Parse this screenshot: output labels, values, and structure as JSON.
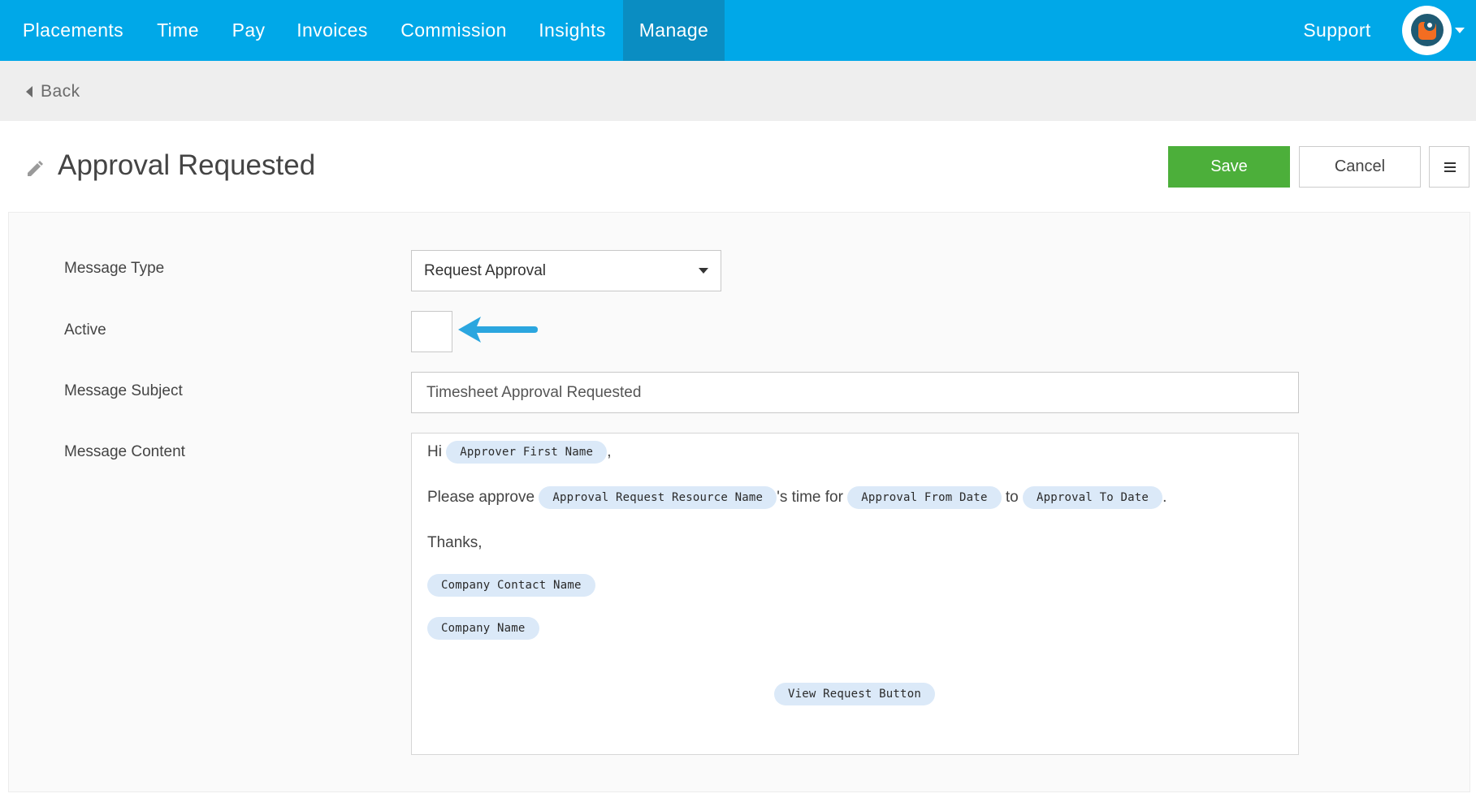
{
  "nav": {
    "items": [
      {
        "label": "Placements",
        "active": false
      },
      {
        "label": "Time",
        "active": false
      },
      {
        "label": "Pay",
        "active": false
      },
      {
        "label": "Invoices",
        "active": false
      },
      {
        "label": "Commission",
        "active": false
      },
      {
        "label": "Insights",
        "active": false
      },
      {
        "label": "Manage",
        "active": true
      }
    ],
    "support_label": "Support",
    "avatar_icon": "user-avatar-icon",
    "colors": {
      "bar": "#00a8e8",
      "active": "#0a8dc2"
    }
  },
  "backbar": {
    "back_label": "Back",
    "back_icon": "caret-left-icon"
  },
  "header": {
    "title": "Approval Requested",
    "edit_icon": "pencil-icon",
    "save_label": "Save",
    "cancel_label": "Cancel",
    "menu_icon": "hamburger-menu-icon",
    "save_color": "#4caf3a"
  },
  "form": {
    "message_type": {
      "label": "Message Type",
      "value": "Request Approval"
    },
    "active": {
      "label": "Active",
      "checked": false,
      "annotation_icon": "arrow-left-icon"
    },
    "message_subject": {
      "label": "Message Subject",
      "value": "Timesheet Approval Requested"
    },
    "message_content": {
      "label": "Message Content",
      "greeting": "Hi",
      "approver_first_name": "Approver First Name",
      "comma": ",",
      "please_approve": "Please approve",
      "resource_name": "Approval Request Resource Name",
      "time_for": "'s time for",
      "from_date": "Approval From Date",
      "to": "to",
      "to_date": "Approval To Date",
      "period": ".",
      "thanks": "Thanks,",
      "company_contact_name": "Company Contact Name",
      "company_name": "Company Name",
      "view_request_button": "View Request Button"
    }
  }
}
